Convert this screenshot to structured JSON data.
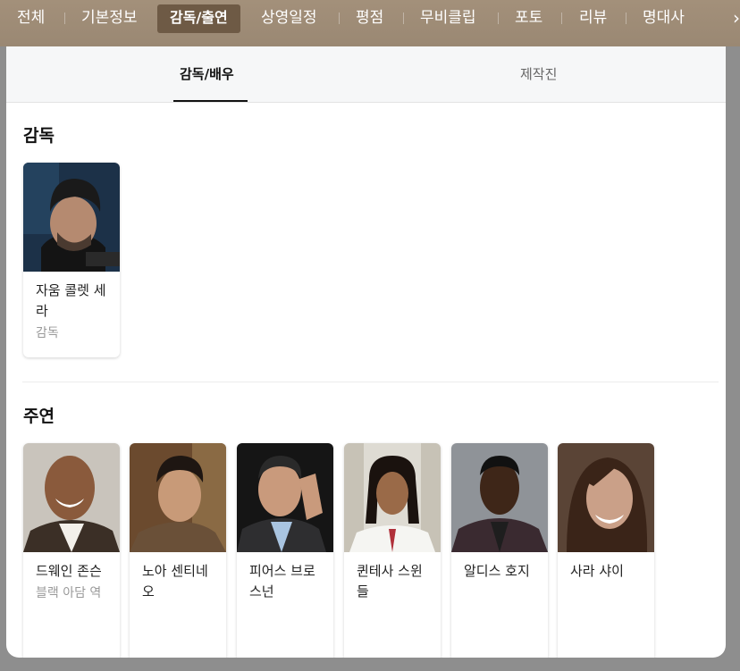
{
  "nav": {
    "items": [
      "전체",
      "기본정보",
      "감독/출연",
      "상영일정",
      "평점",
      "무비클립",
      "포토",
      "리뷰",
      "명대사"
    ],
    "active": "감독/출연"
  },
  "subtabs": [
    "감독/배우",
    "제작진"
  ],
  "sections": {
    "director": {
      "title": "감독",
      "people": [
        {
          "name": "자움 콜렛 세라",
          "role": "감독"
        }
      ]
    },
    "cast": {
      "title": "주연",
      "people": [
        {
          "name": "드웨인 존슨",
          "role": "블랙 아담 역"
        },
        {
          "name": "노아 센티네오",
          "role": ""
        },
        {
          "name": "피어스 브로스넌",
          "role": ""
        },
        {
          "name": "퀸테사 스윈들",
          "role": ""
        },
        {
          "name": "알디스 호지",
          "role": ""
        },
        {
          "name": "사라 샤이",
          "role": ""
        }
      ]
    }
  },
  "colors": {
    "nav_bg": "#9a8873",
    "nav_active": "#6e5a45"
  }
}
